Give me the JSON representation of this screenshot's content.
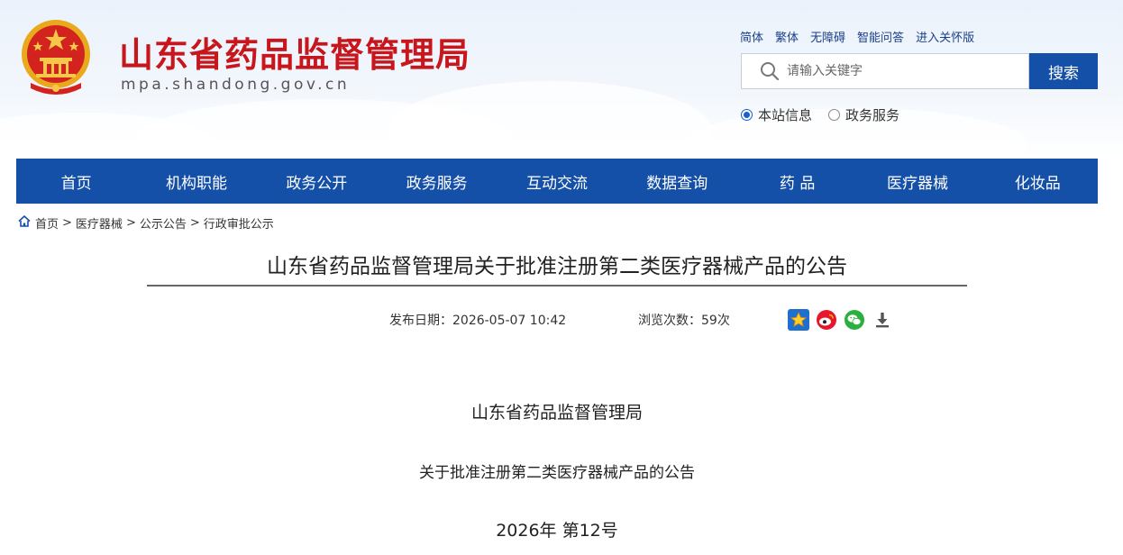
{
  "header": {
    "site_title": "山东省药品监督管理局",
    "site_domain": "mpa.shandong.gov.cn",
    "emblem_icon": "national-emblem-icon",
    "top_links": [
      "简体",
      "繁体",
      "无障碍",
      "智能问答",
      "进入关怀版"
    ],
    "search": {
      "placeholder": "请输入关键字",
      "button_label": "搜索"
    },
    "scope_options": [
      {
        "label": "本站信息",
        "selected": true
      },
      {
        "label": "政务服务",
        "selected": false
      }
    ]
  },
  "nav": {
    "items": [
      "首页",
      "机构职能",
      "政务公开",
      "政务服务",
      "互动交流",
      "数据查询",
      "药 品",
      "医疗器械",
      "化妆品"
    ]
  },
  "breadcrumb": {
    "items": [
      "首页",
      "医疗器械",
      "公示公告",
      "行政审批公示"
    ],
    "separator": ">"
  },
  "article": {
    "title": "山东省药品监督管理局关于批准注册第二类医疗器械产品的公告",
    "publish_date": "发布日期：2026-05-07 10:42",
    "views": "浏览次数：59次",
    "share_icons": [
      "favorite-star-icon",
      "weibo-icon",
      "wechat-icon",
      "download-icon"
    ],
    "body": {
      "line1": "山东省药品监督管理局",
      "line2": "关于批准注册第二类医疗器械产品的公告",
      "line3": "2026年  第12号"
    }
  },
  "colors": {
    "brand_red": "#c8161d",
    "nav_blue": "#1550a8",
    "link_blue": "#1a3f8a"
  }
}
